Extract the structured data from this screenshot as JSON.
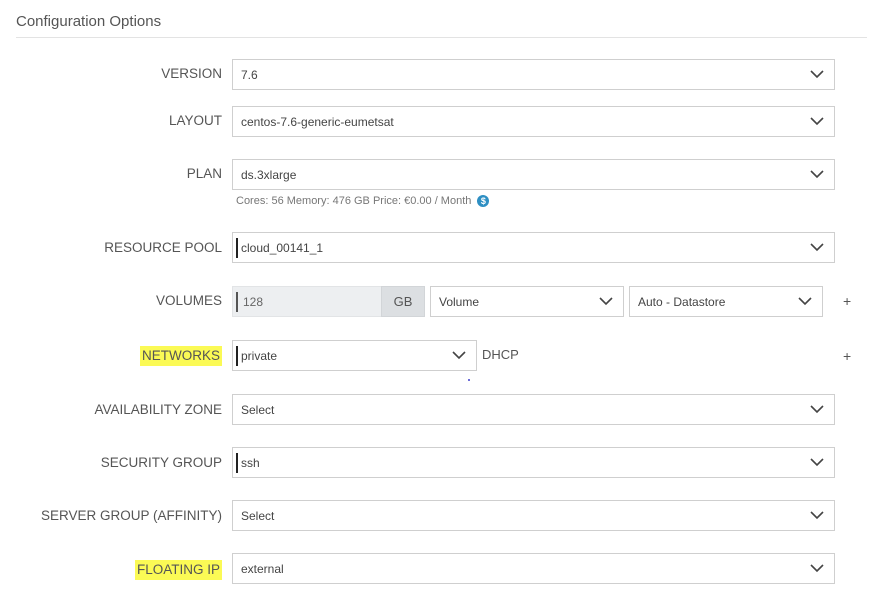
{
  "title": "Configuration Options",
  "fields": {
    "version": {
      "label": "VERSION",
      "value": "7.6"
    },
    "layout": {
      "label": "LAYOUT",
      "value": "centos-7.6-generic-eumetsat"
    },
    "plan": {
      "label": "PLAN",
      "value": "ds.3xlarge",
      "hint": "Cores: 56  Memory: 476 GB  Price: €0.00 / Month",
      "hint_icon": "dollar-info-icon",
      "hint_icon_char": "$"
    },
    "resource_pool": {
      "label": "RESOURCE POOL",
      "value": "cloud_00141_1"
    },
    "volumes": {
      "label": "VOLUMES",
      "size": "128",
      "unit": "GB",
      "type": "Volume",
      "datastore": "Auto - Datastore",
      "add": "+"
    },
    "networks": {
      "label": "NETWORKS",
      "value": "private",
      "mode": "DHCP",
      "add": "+"
    },
    "availability_zone": {
      "label": "AVAILABILITY ZONE",
      "value": "Select"
    },
    "security_group": {
      "label": "SECURITY GROUP",
      "value": "ssh"
    },
    "server_group": {
      "label": "SERVER GROUP (AFFINITY)",
      "value": "Select"
    },
    "floating_ip": {
      "label": "FLOATING IP",
      "value": "external"
    }
  },
  "colors": {
    "highlight": "#fbfa55",
    "info_icon": "#2e8fc3",
    "input_bg": "#edeff1"
  }
}
